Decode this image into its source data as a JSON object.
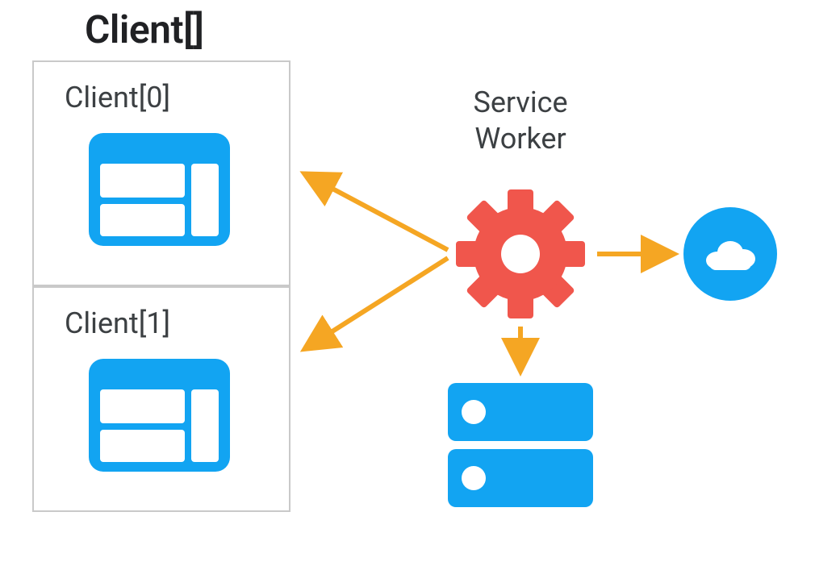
{
  "diagram": {
    "title": "Client[]",
    "clients": [
      {
        "label": "Client[0]"
      },
      {
        "label": "Client[1]"
      }
    ],
    "service_worker_label_line1": "Service",
    "service_worker_label_line2": "Worker",
    "colors": {
      "blue": "#12a4f2",
      "red": "#f0564c",
      "orange": "#f5a623",
      "gray_border": "#c9c9c9",
      "text": "#3c4043"
    },
    "nodes": {
      "client0": {
        "type": "browser-window",
        "role": "client"
      },
      "client1": {
        "type": "browser-window",
        "role": "client"
      },
      "service_worker": {
        "type": "gear",
        "role": "service-worker"
      },
      "database": {
        "type": "server-stack",
        "role": "storage"
      },
      "cloud": {
        "type": "cloud",
        "role": "network"
      }
    },
    "edges": [
      {
        "from": "service_worker",
        "to": "client0",
        "style": "arrow"
      },
      {
        "from": "service_worker",
        "to": "client1",
        "style": "arrow"
      },
      {
        "from": "service_worker",
        "to": "database",
        "style": "arrow"
      },
      {
        "from": "service_worker",
        "to": "cloud",
        "style": "arrow"
      }
    ]
  }
}
